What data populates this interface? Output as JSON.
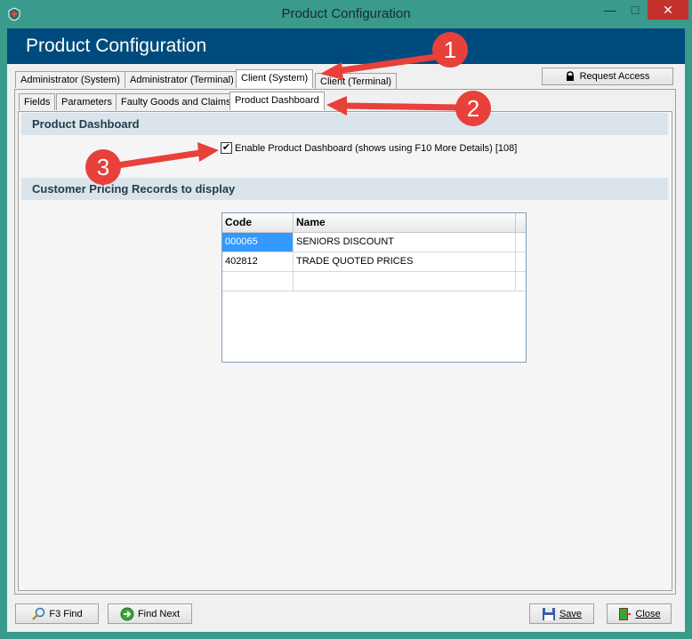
{
  "window": {
    "title": "Product Configuration"
  },
  "header": {
    "title": "Product Configuration"
  },
  "tabs_row1": [
    "Administrator (System)",
    "Administrator (Terminal)",
    "Client (System)",
    "Client (Terminal)"
  ],
  "tabs_row2": [
    "Fields",
    "Parameters",
    "Faulty Goods and Claims",
    "Product Dashboard"
  ],
  "request_access": {
    "label": "Request Access"
  },
  "sections": {
    "dashboard": "Product Dashboard",
    "pricing": "Customer Pricing Records to display"
  },
  "checkbox": {
    "label": "Enable Product Dashboard (shows using F10 More Details) [108]",
    "checked": true
  },
  "grid": {
    "headers": [
      "Code",
      "Name"
    ],
    "rows": [
      [
        "000065",
        "SENIORS DISCOUNT"
      ],
      [
        "402812",
        "TRADE QUOTED PRICES"
      ]
    ]
  },
  "buttons": {
    "find": "F3 Find",
    "find_next": "Find Next",
    "save": "Save",
    "close": "Close"
  },
  "annotations": [
    "1",
    "2",
    "3"
  ],
  "colors": {
    "title_bar": "#3a9a8c",
    "header": "#004b7d",
    "section": "#d9e4ec",
    "selection": "#3399ff",
    "annotation": "#e8403a"
  }
}
